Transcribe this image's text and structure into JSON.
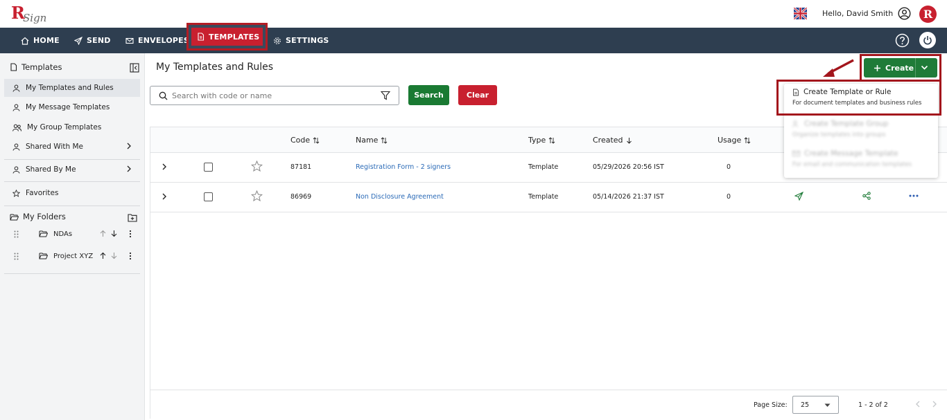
{
  "header": {
    "logo_text": "RSign",
    "greeting": "Hello, David Smith",
    "avatar_letter": "R"
  },
  "nav": {
    "home": "HOME",
    "send": "SEND",
    "envelopes": "ENVELOPES",
    "templates": "TEMPLATES",
    "settings": "SETTINGS"
  },
  "sidebar": {
    "title": "Templates",
    "items": [
      {
        "label": "My Templates and Rules"
      },
      {
        "label": "My Message Templates"
      },
      {
        "label": "My Group Templates"
      },
      {
        "label": "Shared With Me"
      },
      {
        "label": "Shared By Me"
      },
      {
        "label": "Favorites"
      }
    ],
    "folders_title": "My Folders",
    "folders": [
      {
        "name": "NDAs"
      },
      {
        "name": "Project XYZ"
      }
    ]
  },
  "main": {
    "title": "My Templates and Rules",
    "search_placeholder": "Search with code or name",
    "search_button": "Search",
    "clear_button": "Clear",
    "create_button": "Create"
  },
  "dropdown": {
    "items": [
      {
        "title": "Create Template or Rule",
        "subtitle": "For document templates and business rules"
      },
      {
        "title": "Create Template Group",
        "subtitle": "Organize templates into groups"
      },
      {
        "title": "Create Message Template",
        "subtitle": "For email and communication templates"
      }
    ]
  },
  "table": {
    "columns": {
      "code": "Code",
      "name": "Name",
      "type": "Type",
      "created": "Created",
      "usage": "Usage"
    },
    "rows": [
      {
        "code": "87181",
        "name": "Registration Form - 2 signers",
        "type": "Template",
        "created": "05/29/2026 20:56 IST",
        "usage": "0"
      },
      {
        "code": "86969",
        "name": "Non Disclosure Agreement",
        "type": "Template",
        "created": "05/14/2026 21:37 IST",
        "usage": "0"
      }
    ]
  },
  "pagination": {
    "page_size_label": "Page Size:",
    "page_size": "25",
    "range": "1 - 2 of 2"
  },
  "colors": {
    "brand_red": "#c8202f",
    "nav_bg": "#2e3e50",
    "primary_green": "#1f7b38",
    "link_blue": "#2a6ab7",
    "annotation_red": "#a3151c"
  }
}
